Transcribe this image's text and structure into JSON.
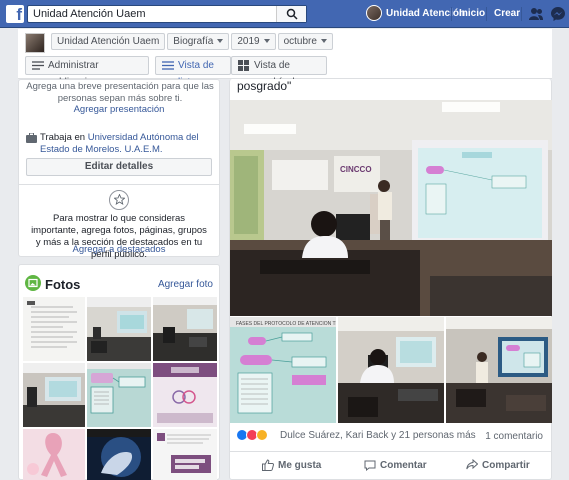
{
  "topbar": {
    "search_value": "Unidad Atención Uaem",
    "user_name": "Unidad Atención",
    "home": "Inicio",
    "create": "Crear"
  },
  "header": {
    "crumbs": [
      {
        "label": "Unidad Atención Uaem",
        "caret": false
      },
      {
        "label": "Biografía",
        "caret": true
      },
      {
        "label": "2019",
        "caret": true
      },
      {
        "label": "octubre",
        "caret": true
      }
    ],
    "manage_posts": "Administrar publicaciones",
    "list_view": "Vista de lista",
    "grid_view": "Vista de cuadrícula"
  },
  "intro": {
    "bio_hint": "Agrega una breve presentación para que las personas sepan más sobre ti.",
    "add_bio": "Agregar presentación",
    "works_prefix": "Trabaja en ",
    "works_link": "Universidad Autónoma del Estado de Morelos. U.A.E.M.",
    "edit_details": "Editar detalles",
    "featured_hint": "Para mostrar lo que consideras importante, agrega fotos, páginas, grupos y más a la sección de destacados en tu perfil público.",
    "add_featured": "Agregar a destacados"
  },
  "photos": {
    "title": "Fotos",
    "add": "Agregar foto"
  },
  "post": {
    "text": "posgrado\"",
    "reactions_text": "Dulce Suárez, Kari Back y 21 personas más",
    "comments": "1 comentario",
    "like": "Me gusta",
    "comment": "Comentar",
    "share": "Compartir"
  },
  "colors": {
    "brand": "#4267b2",
    "link": "#365899"
  }
}
